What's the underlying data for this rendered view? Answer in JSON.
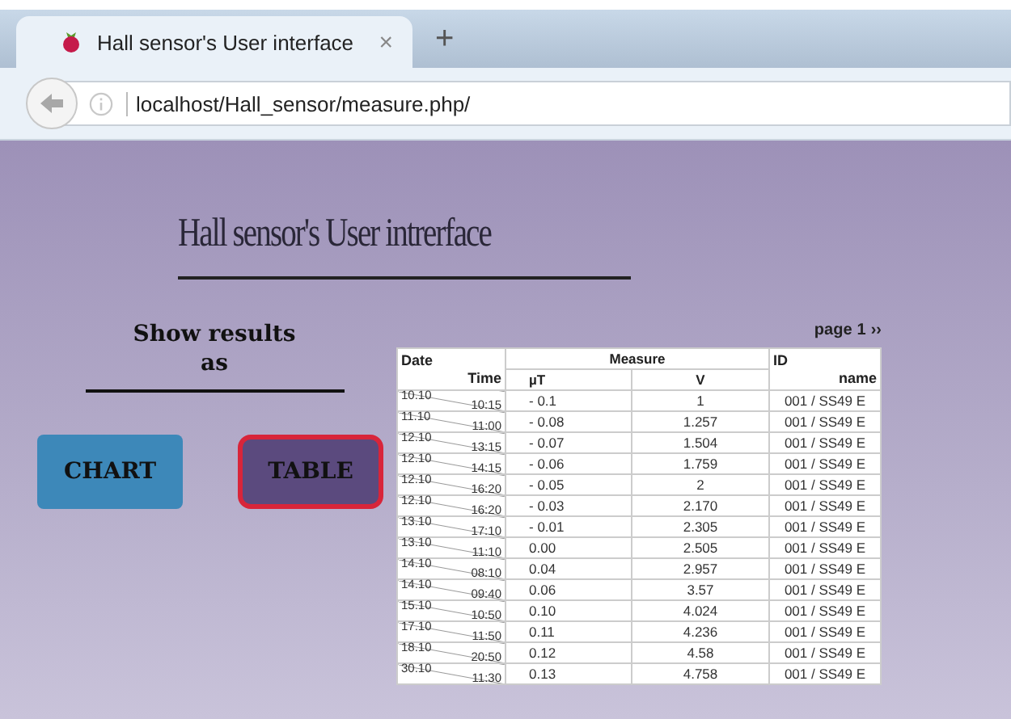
{
  "browser": {
    "tab_title": "Hall sensor's User interface",
    "tab_close": "×",
    "new_tab": "+",
    "url": "localhost/Hall_sensor/measure.php/"
  },
  "page": {
    "title": "Hall sensor's User intrerface",
    "show_label": "Show results",
    "show_label_2": "as",
    "buttons": [
      {
        "label": "CHART",
        "selected": false
      },
      {
        "label": "TABLE",
        "selected": true
      }
    ],
    "pager": {
      "label": "page",
      "number": "1",
      "next": "››"
    },
    "table": {
      "header": {
        "date": "Date",
        "time": "Time",
        "measure": "Measure",
        "ut": "µT",
        "v": "V",
        "id": "ID",
        "name": "name"
      },
      "rows": [
        {
          "date": "10.10",
          "time": "10:15",
          "ut": "- 0.1",
          "v": "1",
          "id": "001 / SS49 E"
        },
        {
          "date": "11.10",
          "time": "11:00",
          "ut": "- 0.08",
          "v": "1.257",
          "id": "001 / SS49 E"
        },
        {
          "date": "12.10",
          "time": "13:15",
          "ut": "- 0.07",
          "v": "1.504",
          "id": "001 / SS49 E"
        },
        {
          "date": "12.10",
          "time": "14:15",
          "ut": "- 0.06",
          "v": "1.759",
          "id": "001 / SS49 E"
        },
        {
          "date": "12.10",
          "time": "16:20",
          "ut": "- 0.05",
          "v": "2",
          "id": "001 / SS49 E"
        },
        {
          "date": "12.10",
          "time": "16:20",
          "ut": "- 0.03",
          "v": "2.170",
          "id": "001 / SS49 E"
        },
        {
          "date": "13.10",
          "time": "17:10",
          "ut": "- 0.01",
          "v": "2.305",
          "id": "001 / SS49 E"
        },
        {
          "date": "13.10",
          "time": "11:10",
          "ut": "0.00",
          "v": "2.505",
          "id": "001 / SS49 E"
        },
        {
          "date": "14.10",
          "time": "08:10",
          "ut": "0.04",
          "v": "2.957",
          "id": "001 / SS49 E"
        },
        {
          "date": "14.10",
          "time": "09:40",
          "ut": "0.06",
          "v": "3.57",
          "id": "001 / SS49 E"
        },
        {
          "date": "15.10",
          "time": "10:50",
          "ut": "0.10",
          "v": "4.024",
          "id": "001 / SS49 E"
        },
        {
          "date": "17.10",
          "time": "11:50",
          "ut": "0.11",
          "v": "4.236",
          "id": "001 / SS49 E"
        },
        {
          "date": "18.10",
          "time": "20:50",
          "ut": "0.12",
          "v": "4.58",
          "id": "001 / SS49 E"
        },
        {
          "date": "30.10",
          "time": "11:30",
          "ut": "0.13",
          "v": "4.758",
          "id": "001 / SS49 E"
        }
      ]
    }
  }
}
